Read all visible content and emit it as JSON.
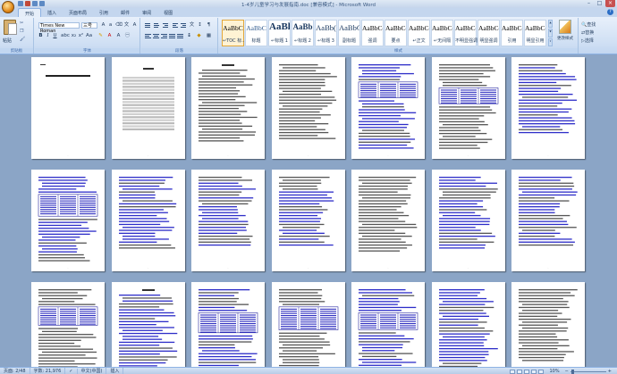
{
  "window": {
    "title": "1-4岁儿童学习与发展指南.doc [兼容模式] - Microsoft Word",
    "controls": [
      "–",
      "□",
      "×"
    ]
  },
  "tabs": [
    {
      "label": "开始",
      "active": true
    },
    {
      "label": "插入",
      "active": false
    },
    {
      "label": "页面布局",
      "active": false
    },
    {
      "label": "引用",
      "active": false
    },
    {
      "label": "邮件",
      "active": false
    },
    {
      "label": "审阅",
      "active": false
    },
    {
      "label": "视图",
      "active": false
    }
  ],
  "ribbon": {
    "clipboard": {
      "label": "剪贴板",
      "paste": "粘贴"
    },
    "font": {
      "label": "字体",
      "name": "Times New Roman",
      "size": "三号"
    },
    "paragraph": {
      "label": "段落"
    },
    "styles": {
      "label": "样式",
      "items": [
        {
          "sample": "AaBbC",
          "name": "↵TOC 标...",
          "kind": "normal",
          "selected": true
        },
        {
          "sample": "AaBbC",
          "name": "标题",
          "kind": "blue"
        },
        {
          "sample": "AaBl",
          "name": "↵标题 1",
          "kind": "big"
        },
        {
          "sample": "AaBb",
          "name": "↵标题 2",
          "kind": "h2"
        },
        {
          "sample": "AaBb(",
          "name": "↵标题 3",
          "kind": "h3"
        },
        {
          "sample": "AaBbC",
          "name": "副标题",
          "kind": "h3"
        },
        {
          "sample": "AaBbCcD",
          "name": "强调",
          "kind": "normal"
        },
        {
          "sample": "AaBbCcD",
          "name": "要点",
          "kind": "normal"
        },
        {
          "sample": "AaBbCcD",
          "name": "↵正文",
          "kind": "normal"
        },
        {
          "sample": "AaBbCcD",
          "name": "↵无间隔",
          "kind": "normal"
        },
        {
          "sample": "AaBbCcD",
          "name": "不明显强调",
          "kind": "normal"
        },
        {
          "sample": "AaBbCcD",
          "name": "明显强调",
          "kind": "normal"
        },
        {
          "sample": "AaBbCcD",
          "name": "引用",
          "kind": "normal"
        },
        {
          "sample": "AaBbCcD",
          "name": "明显引用",
          "kind": "normal"
        }
      ],
      "change_styles": "更改样式"
    },
    "editing": {
      "find": "查找",
      "replace": "替换",
      "select": "选择"
    }
  },
  "status": {
    "page": "页面: 2/48",
    "words": "字数: 21,976",
    "language": "中文(中国)",
    "mode": "插入",
    "zoom": "10%"
  },
  "zoom_level": 0.1
}
